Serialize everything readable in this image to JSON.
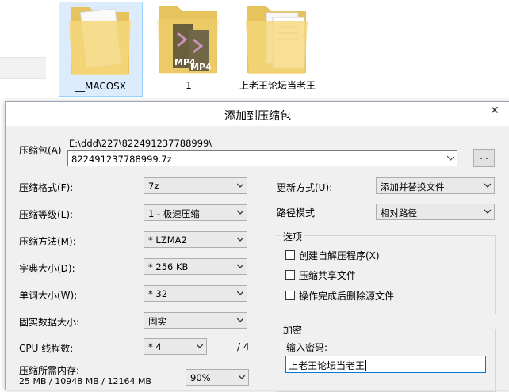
{
  "explorer": {
    "folders": [
      {
        "name": "__MACOSX",
        "selected": true,
        "icon": "folder-document-icon"
      },
      {
        "name": "1",
        "selected": false,
        "icon": "folder-mp4-icon",
        "overlay": [
          "MP4",
          "MP4"
        ]
      },
      {
        "name": "上老王论坛当老王",
        "selected": false,
        "icon": "folder-files-icon"
      }
    ]
  },
  "dialog": {
    "title": "添加到压缩包",
    "close_glyph": "✕",
    "archive": {
      "label": "压缩包(A)",
      "path": "E:\\ddd\\227\\822491237788999\\",
      "value": "822491237788999.7z",
      "browse_label": "..."
    },
    "left": {
      "format": {
        "label": "压缩格式(F):",
        "value": "7z"
      },
      "level": {
        "label": "压缩等级(L):",
        "value": "1 - 极速压缩"
      },
      "method": {
        "label": "压缩方法(M):",
        "value": "* LZMA2"
      },
      "dict": {
        "label": "字典大小(D):",
        "value": "* 256 KB"
      },
      "word": {
        "label": "单词大小(W):",
        "value": "* 32"
      },
      "solid": {
        "label": "固实数据大小:",
        "value": "固实"
      },
      "threads": {
        "label": "CPU 线程数:",
        "value": "* 4",
        "total": "/ 4"
      },
      "memory": {
        "label": "压缩所需内存:",
        "values": "25 MB / 10948 MB / 12164 MB",
        "percent": "90%"
      }
    },
    "right": {
      "update": {
        "label": "更新方式(U):",
        "value": "添加并替换文件"
      },
      "path_mode": {
        "label": "路径模式",
        "value": "相对路径"
      },
      "options": {
        "title": "选项",
        "items": [
          {
            "label": "创建自解压程序(X)",
            "checked": false
          },
          {
            "label": "压缩共享文件",
            "checked": false
          },
          {
            "label": "操作完成后删除源文件",
            "checked": false
          }
        ]
      },
      "encryption": {
        "title": "加密",
        "password_label": "输入密码:",
        "password_value": "上老王论坛当老王"
      }
    }
  }
}
